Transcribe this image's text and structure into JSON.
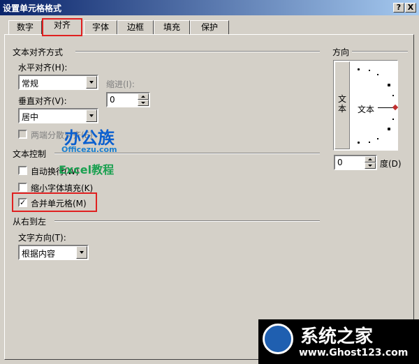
{
  "window": {
    "title": "设置单元格格式",
    "help_label": "?",
    "close_label": "X"
  },
  "tabs": [
    "数字",
    "对齐",
    "字体",
    "边框",
    "填充",
    "保护"
  ],
  "active_tab": "对齐",
  "text_alignment": {
    "group_label": "文本对齐方式",
    "horizontal": {
      "label": "水平对齐(H):",
      "value": "常规"
    },
    "indent": {
      "label": "缩进(I):",
      "value": "0"
    },
    "vertical": {
      "label": "垂直对齐(V):",
      "value": "居中"
    },
    "justify_distributed": {
      "label": "两端分散对齐(E)",
      "checked": false,
      "enabled": false
    }
  },
  "text_control": {
    "group_label": "文本控制",
    "wrap_text": {
      "label": "自动换行(W)",
      "checked": false
    },
    "shrink_to_fit": {
      "label": "缩小字体填充(K)",
      "checked": false
    },
    "merge_cells": {
      "label": "合并单元格(M)",
      "checked": true,
      "check_mark": "✓"
    }
  },
  "rtl": {
    "group_label": "从右到左",
    "direction": {
      "label": "文字方向(T):",
      "value": "根据内容"
    }
  },
  "orientation": {
    "group_label": "方向",
    "vertical_text": "文本",
    "horizontal_text": "文本",
    "degrees": {
      "value": "0",
      "label": "度(D)"
    }
  },
  "watermark": {
    "line1": "办公族",
    "line2": "Officezu.com",
    "line3": "Excel教程"
  },
  "site_logo": {
    "name": "系统之家",
    "url": "www.Ghost123.com"
  },
  "colors": {
    "title_bar": "#0a246a",
    "highlight": "#e02020",
    "dialog_bg": "#d4d0c8"
  }
}
